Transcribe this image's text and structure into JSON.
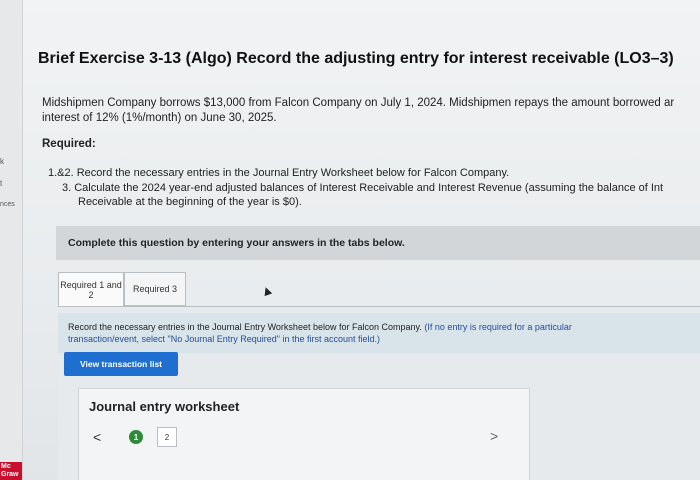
{
  "sidebar": {
    "items": [
      "k",
      "t",
      "nces"
    ],
    "logo": "Mc\nGraw"
  },
  "header": {
    "title": "Brief Exercise 3-13 (Algo) Record the adjusting entry for interest receivable (LO3–3)"
  },
  "problem": {
    "intro_line1": "Midshipmen Company borrows $13,000 from Falcon Company on July 1, 2024. Midshipmen repays the amount borrowed ar",
    "intro_line2": "interest of 12% (1%/month) on June 30, 2025.",
    "required_heading": "Required:",
    "req1": "1.&2. Record the necessary entries in the Journal Entry Worksheet below for Falcon Company.",
    "req3_line1": "3. Calculate the 2024 year-end adjusted balances of Interest Receivable and Interest Revenue (assuming the balance of Int",
    "req3_line2": "Receivable at the beginning of the year is $0)."
  },
  "banner": {
    "text": "Complete this question by entering your answers in the tabs below."
  },
  "tabs": [
    {
      "label": "Required 1 and 2"
    },
    {
      "label": "Required 3"
    }
  ],
  "instructions": {
    "line1_main": "Record the necessary entries in the Journal Entry Worksheet below for Falcon Company. ",
    "line1_blue": "(If no entry is required for a particular",
    "line2_blue": "transaction/event, select \"No Journal Entry Required\" in the first account field.)"
  },
  "buttons": {
    "view_transaction_list": "View transaction list"
  },
  "worksheet": {
    "title": "Journal entry worksheet",
    "prev": "<",
    "next": ">",
    "steps": [
      "1",
      "2"
    ]
  },
  "colors": {
    "accent_blue": "#1e6fd0",
    "step_active_green": "#2e8b3a",
    "logo_red": "#c8102e"
  }
}
